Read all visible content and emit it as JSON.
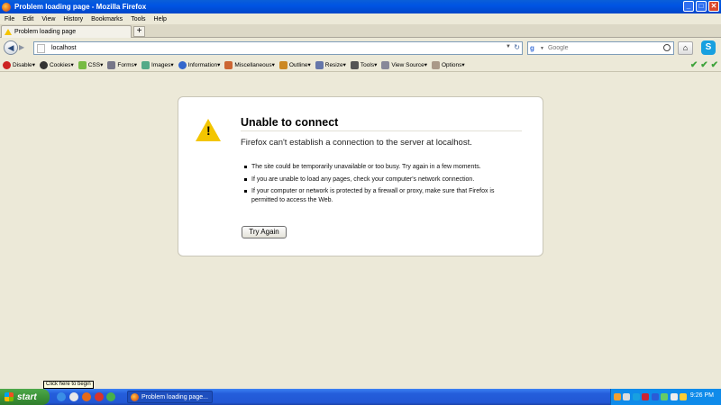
{
  "window": {
    "title": "Problem loading page - Mozilla Firefox",
    "buttons": {
      "minimize": "_",
      "maximize": "□",
      "close": "✕"
    }
  },
  "menubar": [
    "File",
    "Edit",
    "View",
    "History",
    "Bookmarks",
    "Tools",
    "Help"
  ],
  "tabs": [
    {
      "label": "Problem loading page"
    }
  ],
  "newtab_label": "+",
  "navbar": {
    "url": "localhost",
    "search_placeholder": "Google",
    "search_engine_letter": "g"
  },
  "devtoolbar": {
    "items": [
      "Disable",
      "Cookies",
      "CSS",
      "Forms",
      "Images",
      "Information",
      "Miscellaneous",
      "Outline",
      "Resize",
      "Tools",
      "View Source",
      "Options"
    ],
    "colors": [
      "#c22",
      "#333",
      "#7b4",
      "#778",
      "#5a8",
      "#36c",
      "#c63",
      "#c82",
      "#67a",
      "#555",
      "#889",
      "#a98"
    ]
  },
  "error": {
    "title": "Unable to connect",
    "description": "Firefox can't establish a connection to the server at localhost.",
    "bullets": [
      "The site could be temporarily unavailable or too busy. Try again in a few moments.",
      "If you are unable to load any pages, check your computer's network connection.",
      "If your computer or network is protected by a firewall or proxy, make sure that Firefox is permitted to access the Web."
    ],
    "button": "Try Again"
  },
  "tooltip": "Click here to begin",
  "taskbar": {
    "start": "start",
    "task_label": "Problem loading page...",
    "clock": "9:26 PM"
  }
}
